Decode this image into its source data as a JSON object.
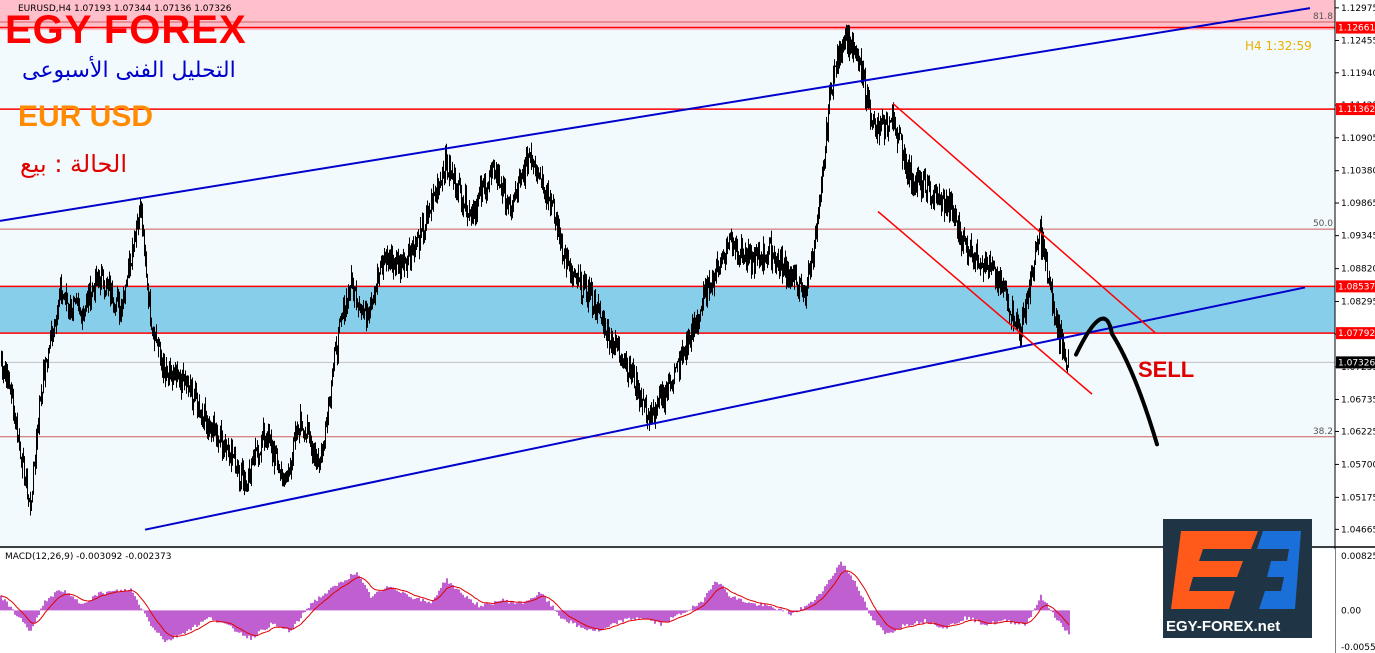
{
  "header": {
    "symbol_line": "EURUSD,H4  1.07193 1.07344 1.07136 1.07326",
    "timeframe_line": "H4   1:32:59"
  },
  "overlay": {
    "brand": "EGY FOREX",
    "subtitle": "التحليل الفنى الأسبوعى",
    "pair": "EUR USD",
    "status": "الحالة : بيع",
    "sell_label": "SELL",
    "logo_site": "EGY-FOREX.net"
  },
  "colors": {
    "candles": "#000000",
    "channel_blue": "#0000cd",
    "level_red": "#ff0000",
    "zone_blue": "#87ceeb",
    "zone_pink": "#ffc0cb",
    "fib_line": "#cd5c5c",
    "macd_hist": "#c060d0",
    "macd_signal": "#e00000",
    "current_price_box": "#000000"
  },
  "chart_data": [
    {
      "type": "candlestick",
      "title": "EURUSD,H4",
      "y_axis": {
        "ylim": [
          1.044,
          1.131
        ],
        "ticks": [
          "1.12975",
          "1.12455",
          "1.11940",
          "1.11425",
          "1.10905",
          "1.10380",
          "1.09865",
          "1.09345",
          "1.08820",
          "1.08295",
          "1.07775",
          "1.07255",
          "1.06735",
          "1.06225",
          "1.05700",
          "1.05175",
          "1.04665"
        ]
      },
      "levels": [
        {
          "label": "1.12661",
          "value": 1.12661,
          "style": "red-box"
        },
        {
          "label": "1.11362",
          "value": 1.11362,
          "style": "red-box"
        },
        {
          "label": "1.08537",
          "value": 1.08537,
          "style": "red-box"
        },
        {
          "label": "1.07792",
          "value": 1.07792,
          "style": "red-box"
        },
        {
          "label": "1.07326",
          "value": 1.07326,
          "style": "current"
        }
      ],
      "fibonacci": [
        {
          "label": "81.8",
          "value": 1.1275
        },
        {
          "label": "50.0",
          "value": 1.0945
        },
        {
          "label": "38.2",
          "value": 1.0614
        }
      ],
      "zones": [
        {
          "name": "resistance-zone",
          "from": 1.1262,
          "to": 1.131,
          "color": "pink"
        },
        {
          "name": "support-zone",
          "from": 1.07792,
          "to": 1.08537,
          "color": "blue"
        }
      ],
      "channels": [
        {
          "name": "upper-channel-line",
          "from": [
            0,
            1.0958
          ],
          "to": [
            1310,
            1.1297
          ]
        },
        {
          "name": "lower-channel-line",
          "from": [
            145,
            1.0466
          ],
          "to": [
            1305,
            1.0852
          ]
        }
      ],
      "bear_channel": [
        {
          "name": "bear-channel-top",
          "from": [
            893,
            1.1145
          ],
          "to": [
            1155,
            1.078
          ]
        },
        {
          "name": "bear-channel-bottom",
          "from": [
            878,
            1.0973
          ],
          "to": [
            1092,
            1.0682
          ]
        }
      ],
      "price_path_anchors": [
        [
          0,
          1.074
        ],
        [
          10,
          1.069
        ],
        [
          20,
          1.059
        ],
        [
          30,
          1.05
        ],
        [
          40,
          1.068
        ],
        [
          50,
          1.077
        ],
        [
          60,
          1.084
        ],
        [
          80,
          1.081
        ],
        [
          100,
          1.087
        ],
        [
          120,
          1.082
        ],
        [
          140,
          1.098
        ],
        [
          150,
          1.081
        ],
        [
          165,
          1.071
        ],
        [
          185,
          1.07
        ],
        [
          210,
          1.063
        ],
        [
          230,
          1.059
        ],
        [
          245,
          1.054
        ],
        [
          265,
          1.062
        ],
        [
          285,
          1.054
        ],
        [
          300,
          1.064
        ],
        [
          320,
          1.057
        ],
        [
          335,
          1.075
        ],
        [
          350,
          1.086
        ],
        [
          365,
          1.081
        ],
        [
          385,
          1.09
        ],
        [
          400,
          1.089
        ],
        [
          420,
          1.093
        ],
        [
          445,
          1.105
        ],
        [
          470,
          1.097
        ],
        [
          495,
          1.104
        ],
        [
          510,
          1.097
        ],
        [
          530,
          1.107
        ],
        [
          550,
          1.099
        ],
        [
          570,
          1.087
        ],
        [
          590,
          1.084
        ],
        [
          610,
          1.077
        ],
        [
          630,
          1.072
        ],
        [
          650,
          1.064
        ],
        [
          670,
          1.07
        ],
        [
          690,
          1.077
        ],
        [
          710,
          1.086
        ],
        [
          730,
          1.093
        ],
        [
          750,
          1.089
        ],
        [
          770,
          1.091
        ],
        [
          790,
          1.087
        ],
        [
          805,
          1.084
        ],
        [
          820,
          1.098
        ],
        [
          830,
          1.117
        ],
        [
          845,
          1.126
        ],
        [
          860,
          1.12
        ],
        [
          875,
          1.11
        ],
        [
          893,
          1.112
        ],
        [
          910,
          1.103
        ],
        [
          930,
          1.1
        ],
        [
          950,
          1.098
        ],
        [
          965,
          1.092
        ],
        [
          985,
          1.089
        ],
        [
          1005,
          1.084
        ],
        [
          1020,
          1.078
        ],
        [
          1040,
          1.094
        ],
        [
          1055,
          1.08
        ],
        [
          1068,
          1.073
        ]
      ]
    },
    {
      "type": "histogram",
      "title": "MACD(12,26,9) -0.003092 -0.002373",
      "y_axis": {
        "ylim": [
          -0.00554,
          0.00825
        ],
        "ticks": [
          "0.00825",
          "0.00",
          "-0.00554"
        ]
      },
      "histogram_anchors": [
        [
          0,
          0.002
        ],
        [
          15,
          -0.0005
        ],
        [
          30,
          -0.003
        ],
        [
          45,
          0.0015
        ],
        [
          60,
          0.003
        ],
        [
          80,
          0.001
        ],
        [
          100,
          0.0025
        ],
        [
          130,
          0.003
        ],
        [
          150,
          -0.002
        ],
        [
          165,
          -0.0045
        ],
        [
          185,
          -0.003
        ],
        [
          210,
          -0.001
        ],
        [
          230,
          -0.0025
        ],
        [
          250,
          -0.004
        ],
        [
          270,
          -0.002
        ],
        [
          290,
          -0.003
        ],
        [
          310,
          0.001
        ],
        [
          330,
          0.003
        ],
        [
          355,
          0.0055
        ],
        [
          370,
          0.002
        ],
        [
          390,
          0.0035
        ],
        [
          410,
          0.002
        ],
        [
          430,
          0.001
        ],
        [
          445,
          0.0045
        ],
        [
          460,
          0.0025
        ],
        [
          480,
          0.0005
        ],
        [
          500,
          0.0015
        ],
        [
          520,
          0.001
        ],
        [
          540,
          0.0025
        ],
        [
          560,
          -0.001
        ],
        [
          580,
          -0.0025
        ],
        [
          600,
          -0.003
        ],
        [
          620,
          -0.0015
        ],
        [
          640,
          -0.001
        ],
        [
          660,
          -0.002
        ],
        [
          680,
          -0.0005
        ],
        [
          700,
          0.001
        ],
        [
          715,
          0.0045
        ],
        [
          730,
          0.002
        ],
        [
          750,
          0.001
        ],
        [
          770,
          0.0005
        ],
        [
          790,
          -0.0005
        ],
        [
          810,
          0.001
        ],
        [
          825,
          0.0035
        ],
        [
          840,
          0.007
        ],
        [
          855,
          0.004
        ],
        [
          870,
          -0.001
        ],
        [
          885,
          -0.0035
        ],
        [
          905,
          -0.002
        ],
        [
          925,
          -0.0015
        ],
        [
          945,
          -0.0025
        ],
        [
          965,
          -0.001
        ],
        [
          985,
          -0.002
        ],
        [
          1005,
          -0.0015
        ],
        [
          1025,
          -0.002
        ],
        [
          1040,
          0.002
        ],
        [
          1055,
          -0.001
        ],
        [
          1068,
          -0.0035
        ]
      ]
    }
  ]
}
